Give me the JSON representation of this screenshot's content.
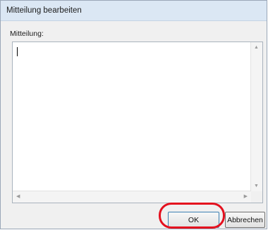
{
  "dialog": {
    "title": "Mitteilung bearbeiten",
    "field_label": "Mitteilung:",
    "message_value": "",
    "ok_label": "OK",
    "cancel_label": "Abbrechen"
  },
  "icons": {
    "scroll_up": "arrow-up-icon",
    "scroll_down": "arrow-down-icon",
    "scroll_left": "arrow-left-icon",
    "scroll_right": "arrow-right-icon"
  },
  "colors": {
    "highlight": "#e4101e",
    "titlebar": "#dbe7f4",
    "dialog_bg": "#f0f0f0"
  }
}
